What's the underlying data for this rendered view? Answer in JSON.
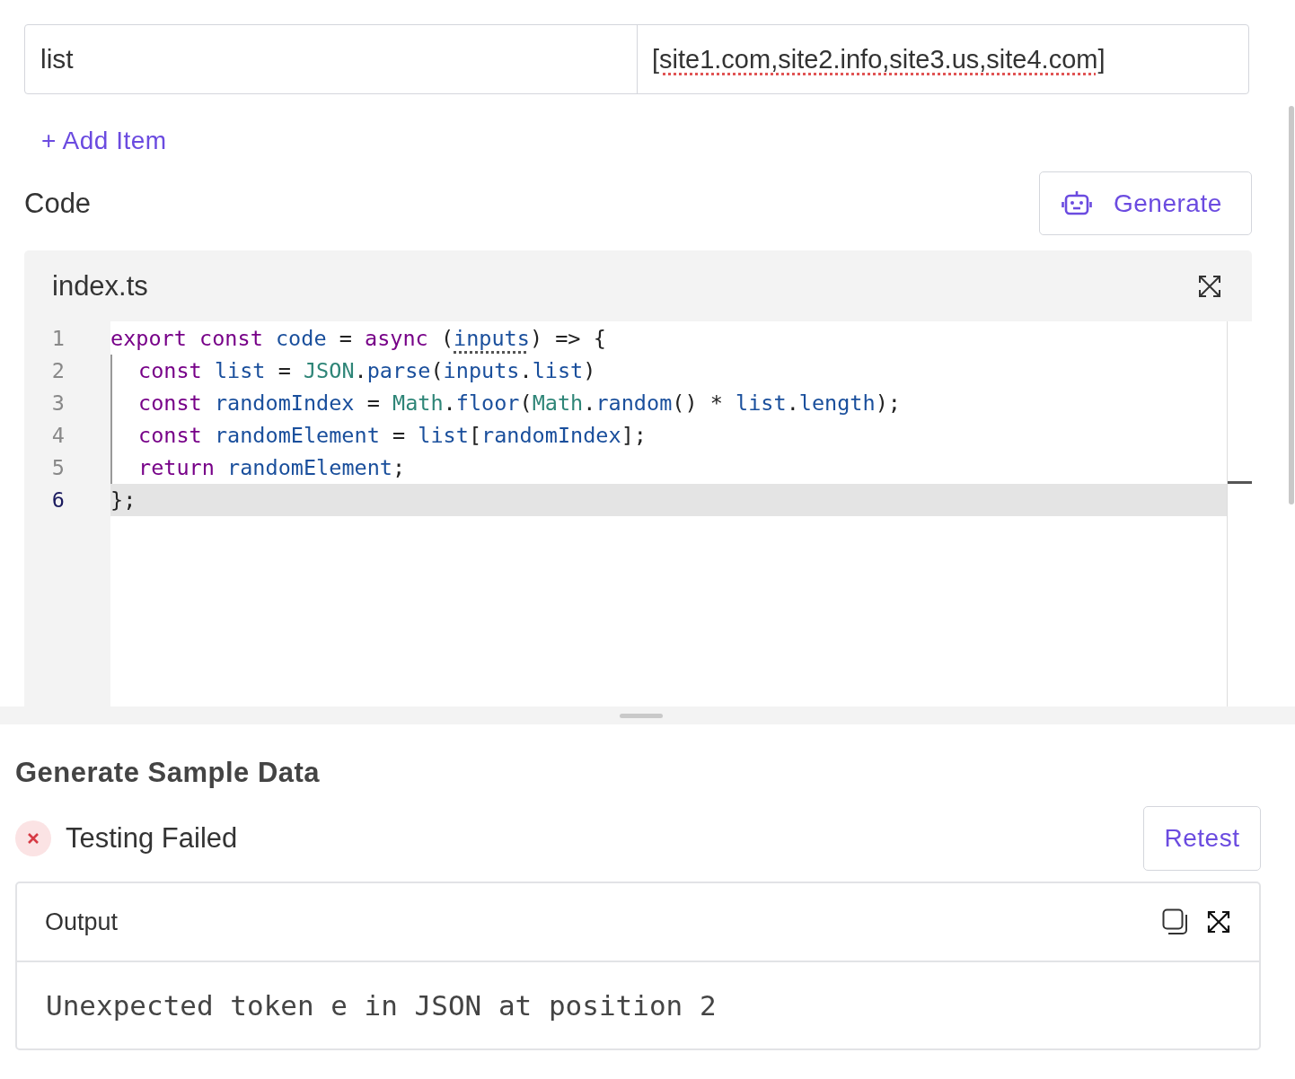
{
  "input_row": {
    "key": "list",
    "value": "[site1.com,site2.info,site3.us,site4.com]"
  },
  "add_item": "+ Add Item",
  "code_section": {
    "title": "Code",
    "generate_button": "Generate"
  },
  "editor": {
    "filename": "index.ts",
    "lines": [
      {
        "number": "1",
        "indented": false,
        "active": false,
        "tokens": [
          {
            "t": "export const ",
            "color": "#770088"
          },
          {
            "t": "code",
            "color": "#1a4f9c"
          },
          {
            "t": " = ",
            "color": "#222222"
          },
          {
            "t": "async",
            "color": "#770088"
          },
          {
            "t": " (",
            "color": "#222222"
          },
          {
            "t": "inputs",
            "color": "#1a4f9c",
            "hint": true
          },
          {
            "t": ") => {",
            "color": "#222222"
          }
        ]
      },
      {
        "number": "2",
        "indented": true,
        "active": false,
        "tokens": [
          {
            "t": "const ",
            "color": "#770088"
          },
          {
            "t": "list",
            "color": "#1a4f9c"
          },
          {
            "t": " = ",
            "color": "#222222"
          },
          {
            "t": "JSON",
            "color": "#2e8577"
          },
          {
            "t": ".",
            "color": "#222222"
          },
          {
            "t": "parse",
            "color": "#1a4f9c"
          },
          {
            "t": "(",
            "color": "#222222"
          },
          {
            "t": "inputs",
            "color": "#1a4f9c"
          },
          {
            "t": ".",
            "color": "#222222"
          },
          {
            "t": "list",
            "color": "#1a4f9c"
          },
          {
            "t": ")",
            "color": "#222222"
          }
        ]
      },
      {
        "number": "3",
        "indented": true,
        "active": false,
        "tokens": [
          {
            "t": "const ",
            "color": "#770088"
          },
          {
            "t": "randomIndex",
            "color": "#1a4f9c"
          },
          {
            "t": " = ",
            "color": "#222222"
          },
          {
            "t": "Math",
            "color": "#2e8577"
          },
          {
            "t": ".",
            "color": "#222222"
          },
          {
            "t": "floor",
            "color": "#1a4f9c"
          },
          {
            "t": "(",
            "color": "#222222"
          },
          {
            "t": "Math",
            "color": "#2e8577"
          },
          {
            "t": ".",
            "color": "#222222"
          },
          {
            "t": "random",
            "color": "#1a4f9c"
          },
          {
            "t": "() * ",
            "color": "#222222"
          },
          {
            "t": "list",
            "color": "#1a4f9c"
          },
          {
            "t": ".",
            "color": "#222222"
          },
          {
            "t": "length",
            "color": "#1a4f9c"
          },
          {
            "t": ");",
            "color": "#222222"
          }
        ]
      },
      {
        "number": "4",
        "indented": true,
        "active": false,
        "tokens": [
          {
            "t": "const ",
            "color": "#770088"
          },
          {
            "t": "randomElement",
            "color": "#1a4f9c"
          },
          {
            "t": " = ",
            "color": "#222222"
          },
          {
            "t": "list",
            "color": "#1a4f9c"
          },
          {
            "t": "[",
            "color": "#222222"
          },
          {
            "t": "randomIndex",
            "color": "#1a4f9c"
          },
          {
            "t": "];",
            "color": "#222222"
          }
        ]
      },
      {
        "number": "5",
        "indented": true,
        "active": false,
        "tokens": [
          {
            "t": "return ",
            "color": "#770088"
          },
          {
            "t": "randomElement",
            "color": "#1a4f9c"
          },
          {
            "t": ";",
            "color": "#222222"
          }
        ]
      },
      {
        "number": "6",
        "indented": false,
        "active": true,
        "tokens": [
          {
            "t": "};",
            "color": "#222222"
          }
        ]
      }
    ]
  },
  "sample_data": {
    "title": "Generate Sample Data",
    "status": "Testing Failed",
    "failed": true,
    "retest_button": "Retest",
    "output": {
      "title": "Output",
      "text": "Unexpected token e in JSON at position 2"
    }
  }
}
